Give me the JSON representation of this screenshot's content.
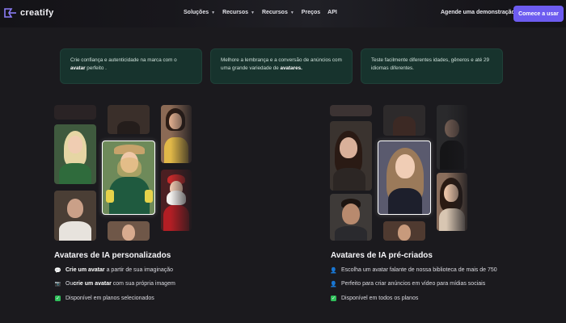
{
  "brand": {
    "name": "creatify",
    "accent": "#6d5cf0"
  },
  "nav": {
    "items": [
      {
        "label": "Soluções",
        "has_dropdown": true
      },
      {
        "label": "Recursos",
        "has_dropdown": true
      },
      {
        "label": "Recursos",
        "has_dropdown": true
      },
      {
        "label": "Preços",
        "has_dropdown": false
      },
      {
        "label": "API",
        "has_dropdown": false
      }
    ],
    "demo_label": "Agende uma demonstração",
    "cta_label": "Comece a usar"
  },
  "cards": [
    {
      "before": "Crie confiança e autenticidade na marca com o ",
      "bold": "avatar",
      "after": " perfeito ."
    },
    {
      "before": "Melhore a lembrança e a conversão de anúncios com uma grande variedade de ",
      "bold": "avatares.",
      "after": ""
    },
    {
      "before": "Teste facilmente diferentes idades, gêneros e até 29 idiomas diferentes.",
      "bold": "",
      "after": ""
    }
  ],
  "left_section": {
    "title": "Avatares de IA personalizados",
    "features": [
      {
        "icon": "speech-bubble-icon",
        "bold": "Crie um avatar",
        "text": " a partir de sua imaginação"
      },
      {
        "icon": "camera-icon",
        "prefix": "Ou",
        "bold": "crie um avatar",
        "text": " com sua própria imagem"
      },
      {
        "icon": "check-icon",
        "text": "Disponível em planos selecionados"
      }
    ]
  },
  "right_section": {
    "title": "Avatares de IA pré-criados",
    "features": [
      {
        "icon": "person-icon",
        "text": "Escolha um avatar falante de nossa biblioteca de mais de 750"
      },
      {
        "icon": "person-icon",
        "text": "Perfeito para criar anúncios em vídeo para mídias sociais"
      },
      {
        "icon": "check-icon",
        "text": "Disponível em todos os planos"
      }
    ]
  }
}
